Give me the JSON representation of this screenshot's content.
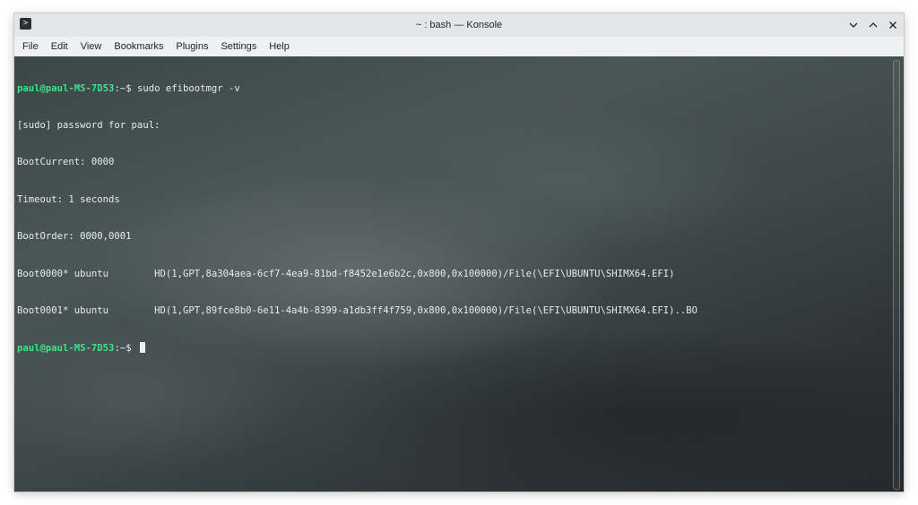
{
  "window": {
    "title": "~ : bash — Konsole",
    "app_icon": "terminal-icon",
    "controls": [
      "chevron-down-icon",
      "chevron-up-icon",
      "close-icon"
    ]
  },
  "menubar": {
    "items": [
      "File",
      "Edit",
      "View",
      "Bookmarks",
      "Plugins",
      "Settings",
      "Help"
    ]
  },
  "terminal": {
    "prompt_user": "paul@paul-MS-7D53",
    "prompt_path": ":~$ ",
    "command": "sudo efibootmgr -v",
    "output": [
      "[sudo] password for paul:",
      "BootCurrent: 0000",
      "Timeout: 1 seconds",
      "BootOrder: 0000,0001",
      "Boot0000* ubuntu        HD(1,GPT,8a304aea-6cf7-4ea9-81bd-f8452e1e6b2c,0x800,0x100000)/File(\\EFI\\UBUNTU\\SHIMX64.EFI)",
      "Boot0001* ubuntu        HD(1,GPT,89fce8b0-6e11-4a4b-8399-a1db3ff4f759,0x800,0x100000)/File(\\EFI\\UBUNTU\\SHIMX64.EFI)..BO"
    ],
    "prompt2_user": "paul@paul-MS-7D53",
    "prompt2_path": ":~$ "
  },
  "colors": {
    "prompt": "#3fe28a",
    "text": "#e8ebeb",
    "chrome": "#eff0f1"
  }
}
